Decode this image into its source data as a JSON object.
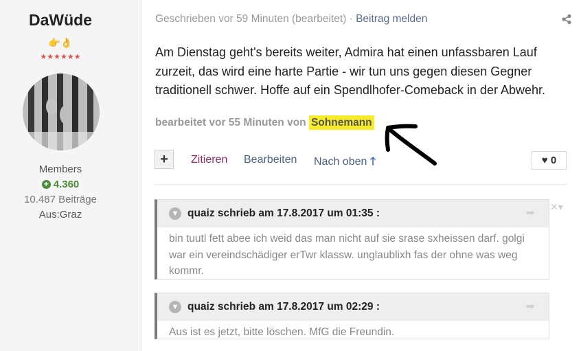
{
  "author": {
    "name": "DaWüde",
    "emoji": "👉👌",
    "stars": "★★★★★★",
    "group": "Members",
    "reputation": "4.360",
    "posts": "10.487 Beiträge",
    "origin": "Aus:Graz"
  },
  "post": {
    "meta_time": "Geschrieben vor 59 Minuten (bearbeitet)",
    "meta_sep": "·",
    "report_label": "Beitrag melden",
    "text": "Am Dienstag geht's bereits weiter, Admira hat einen unfassbaren Lauf zurzeit, das wird eine harte Partie - wir tun uns gegen diesen Gegner traditionell schwer. Hoffe auf ein Spendlhofer-Comeback in der Abwehr.",
    "edited_prefix": "bearbeitet vor 55 Minuten von",
    "edited_by": "Sohnemann",
    "like_count": "0"
  },
  "actions": {
    "plus": "+",
    "quote": "Zitieren",
    "edit": "Bearbeiten",
    "top": "Nach oben",
    "top_arrow": "🡑"
  },
  "quotes": [
    {
      "header": "quaiz schrieb am 17.8.2017 um 01:35 :",
      "body": "bin tuutl fett abee ich weid das man nicht auf sie srase sxheissen darf. golgi war ein vereindschädiger erTwr klassw. unglaublixh fas der ohne was weg kommr."
    },
    {
      "header": "quaiz schrieb am 17.8.2017 um 02:29 :",
      "body": "Aus ist es jetzt, bitte löschen. MfG die Freundin."
    }
  ],
  "colors": {
    "highlight": "#f7ec2b",
    "reputation": "#4c8a3b",
    "quote_link": "#8b2c60",
    "action_link": "#4a6382"
  },
  "icons": [
    "share-icon",
    "plus-icon",
    "arrow-up-icon",
    "heart-icon",
    "chevron-down-icon",
    "forward-icon",
    "close-icon",
    "annotation-arrow"
  ]
}
